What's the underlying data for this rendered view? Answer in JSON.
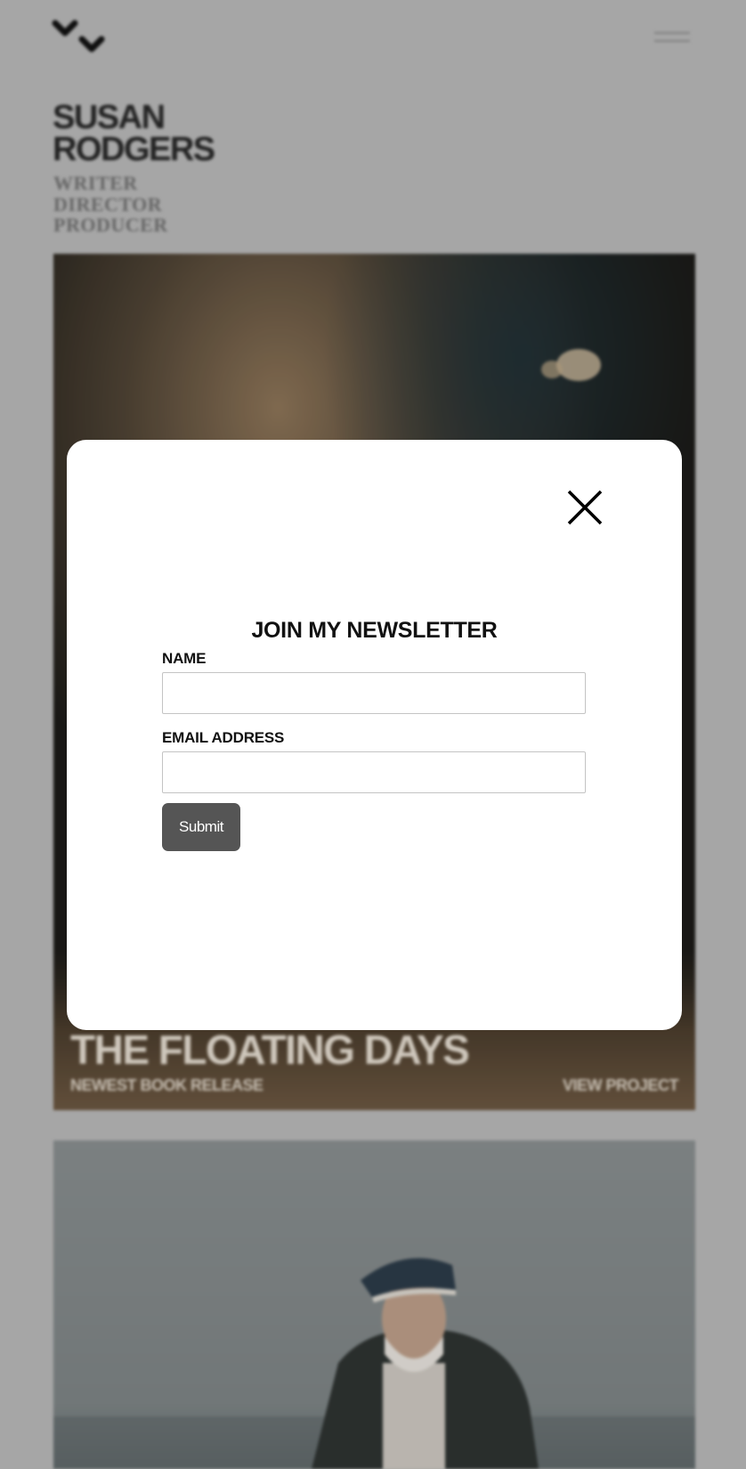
{
  "site": {
    "title_line1": "SUSAN",
    "title_line2": "RODGERS",
    "roles": [
      "WRITER",
      "DIRECTOR",
      "PRODUCER"
    ]
  },
  "header": {
    "logo_icon": "double-chevron-logo-icon",
    "menu_icon": "hamburger-menu-icon"
  },
  "featured": {
    "title": "THE FLOATING DAYS",
    "subtitle": "NEWEST BOOK RELEASE",
    "link_label": "VIEW PROJECT"
  },
  "modal": {
    "heading": "JOIN MY NEWSLETTER",
    "close_icon": "close-icon",
    "fields": {
      "name_label": "NAME",
      "name_value": "",
      "email_label": "EMAIL ADDRESS",
      "email_value": ""
    },
    "submit_label": "Submit"
  },
  "colors": {
    "background": "#b5b5b5",
    "modal_bg": "#ffffff",
    "submit_bg": "#555555",
    "title_text": "#262626",
    "roles_text": "#6f6f6f"
  }
}
